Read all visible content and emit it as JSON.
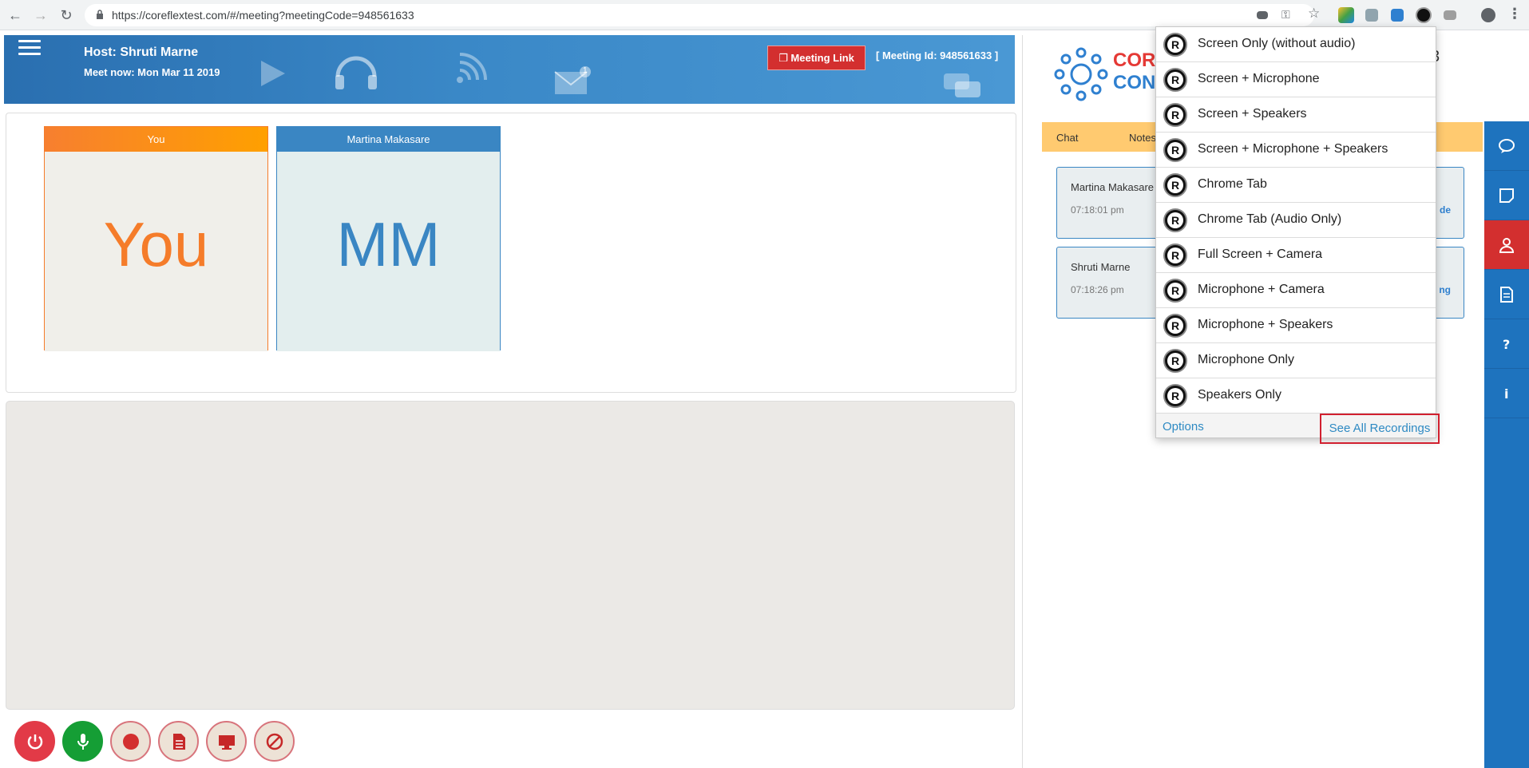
{
  "browser": {
    "url": "https://coreflextest.com/#/meeting?meetingCode=948561633"
  },
  "header": {
    "host": "Host: Shruti Marne",
    "meet_now": "Meet now: Mon Mar 11 2019",
    "meeting_link_label": "Meeting Link",
    "meeting_id": "[ Meeting Id: 948561633 ]",
    "mail_badge": "1"
  },
  "tiles": [
    {
      "header": "You",
      "initials": "You"
    },
    {
      "header": "Martina Makasare",
      "initials": "MM"
    }
  ],
  "right_panel": {
    "logo_line1": "COR",
    "logo_line2": "CON",
    "timer_fragment": "3",
    "tabs": [
      "Chat",
      "Notes"
    ],
    "messages": [
      {
        "name": "Martina Makasare",
        "time": "07:18:01 pm",
        "link": "de"
      },
      {
        "name": "Shruti Marne",
        "time": "07:18:26 pm",
        "link": "ng"
      }
    ]
  },
  "dropdown": {
    "items": [
      "Screen Only (without audio)",
      "Screen + Microphone",
      "Screen + Speakers",
      "Screen + Microphone + Speakers",
      "Chrome Tab",
      "Chrome Tab (Audio Only)",
      "Full Screen + Camera",
      "Microphone + Camera",
      "Microphone + Speakers",
      "Microphone Only",
      "Speakers Only"
    ],
    "badge_letter": "R",
    "options_label": "Options",
    "see_all_label": "See All Recordings"
  },
  "colors": {
    "banner_blue": "#3a88c7",
    "you_orange": "#f57c2a",
    "mm_blue": "#3a86c3",
    "tabs_yellow": "#ffca70",
    "side_bar_blue": "#1e73be",
    "highlight_red": "#d1202f"
  }
}
